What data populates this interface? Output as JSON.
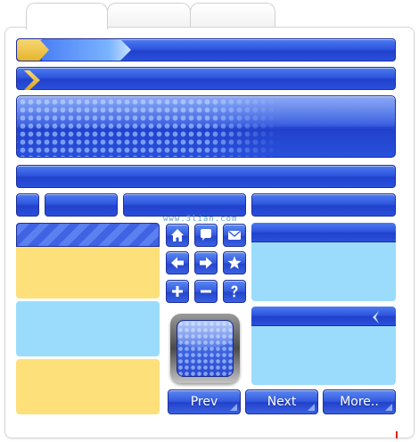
{
  "window": {
    "tabs": [
      "",
      "",
      ""
    ]
  },
  "watermark": "www.3lian.com",
  "icons": [
    {
      "name": "home-icon"
    },
    {
      "name": "speech-bubble-icon"
    },
    {
      "name": "mail-icon"
    },
    {
      "name": "arrow-left-icon"
    },
    {
      "name": "arrow-right-icon"
    },
    {
      "name": "star-icon"
    },
    {
      "name": "plus-icon"
    },
    {
      "name": "minus-icon"
    },
    {
      "name": "question-icon"
    }
  ],
  "nav": {
    "prev_label": "Prev",
    "next_label": "Next",
    "more_label": "More.."
  },
  "colors": {
    "accent_blue": "#2f56df",
    "gold": "#e6b52c",
    "yellow_panel": "#fde07a",
    "light_blue_panel": "#9bdcfc"
  }
}
